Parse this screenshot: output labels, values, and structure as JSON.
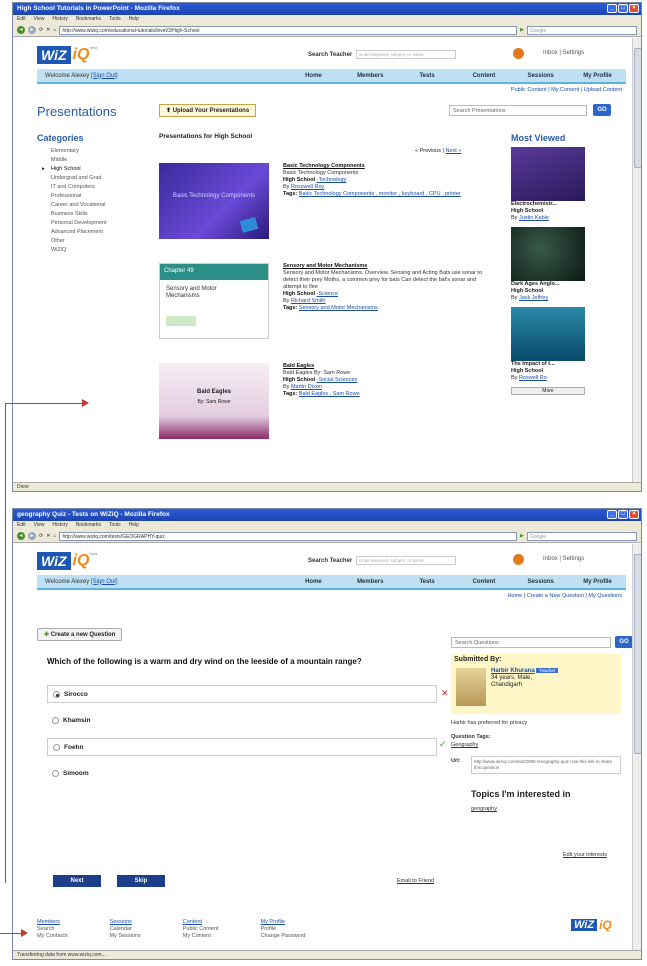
{
  "window1": {
    "title": "High School Tutorials in PowerPoint - Mozilla Firefox",
    "menu": [
      "Edit",
      "View",
      "History",
      "Bookmarks",
      "Tools",
      "Help"
    ],
    "url": "http://www.wiziq.com/educational-tutorials/level/3/High-School",
    "google": "Google",
    "status": "Done",
    "header": {
      "search_label": "Search Teacher",
      "search_placeholder": "Enter keyword, subject, or name",
      "inbox_settings": "Inbox  |  Settings",
      "welcome_text": "Welcome Alexey",
      "sign_out": "[Sign Out]",
      "tabs": [
        "Home",
        "Members",
        "Tests",
        "Content",
        "Sessions",
        "My Profile"
      ],
      "subnav": "Public Content | My Content | Upload Content"
    },
    "page_title": "Presentations",
    "upload_button": "Upload Your Presentations",
    "search_placeholder": "Search Presentations",
    "go": "GO",
    "categories_title": "Categories",
    "categories": [
      "Elementary",
      "Middle",
      "High School",
      "Undergrad and Grad",
      "IT and Computers",
      "Professional",
      "Career and Vocational",
      "Business Skills",
      "Personal Development",
      "Advanced Placement",
      "Other",
      "WiZiQ"
    ],
    "selected_category": "High School",
    "list_heading": "Presentations for High School",
    "pager": {
      "prev": "« Previous",
      "sep": " | ",
      "next": "Next »"
    },
    "presentations": [
      {
        "title": "Basic Technology Components",
        "desc": "Basic Technology Components",
        "level": "High School",
        "subject": "-Technology",
        "by": "By",
        "author": "Rosswell Roy",
        "tags_label": "Tags:",
        "tags": "Basic Technology Components , monitor , keyboard , CPU , printer",
        "slide_title": "Basic Technology Components"
      },
      {
        "title": "Sensory and Motor Mechanisms",
        "desc": "Sensory and Motor Mechanisms. Overview. Sensing and Acting Bats use sonar to detect their prey Moths, a common prey for bats Can detect the bat's sonar and attempt to flee",
        "level": "High School",
        "subject": "-Science",
        "by": "By",
        "author": "Richard Smith",
        "tags_label": "Tags:",
        "tags": "Sensory and Motor Mechanisms",
        "slide_title": "Chapter 49",
        "slide_sub": "Sensory and Motor Mechanisms"
      },
      {
        "title": "Bald Eagles",
        "desc": "Bald Eagles By: Sam Rowe",
        "level": "High School",
        "subject": "-Social Sciences",
        "by": "By",
        "author": "Martin Dixon",
        "tags_label": "Tags:",
        "tags": "Bald Eagles , Sam Rowe",
        "slide_title": "Bald Eagles",
        "slide_sub": "By: Sam Rowe"
      }
    ],
    "most_viewed_title": "Most Viewed",
    "most_viewed": [
      {
        "title": "Electrochemistr...",
        "level": "High School",
        "by": "By",
        "author": "Justin Kable"
      },
      {
        "title": "Dark Ages Anglo...",
        "level": "High School",
        "by": "By",
        "author": "Jack Jeffrey"
      },
      {
        "title": "The Impact of t...",
        "level": "High School",
        "by": "By",
        "author": "Roswell Ro"
      }
    ],
    "more_label": "More"
  },
  "window2": {
    "title": "geography Quiz - Tests on WiZiQ - Mozilla Firefox",
    "menu": [
      "Edit",
      "View",
      "History",
      "Bookmarks",
      "Tools",
      "Help"
    ],
    "url": "http://www.wiziq.com/tests/GEOGRAPHY-quiz",
    "google": "Google",
    "status": "Transferring data from www.wiziq.com...",
    "header": {
      "search_label": "Search Teacher",
      "search_placeholder": "Enter keyword, subject, or name",
      "inbox_settings": "Inbox  |  Settings",
      "welcome_text": "Welcome Alexey",
      "sign_out": "[Sign Out]",
      "tabs": [
        "Home",
        "Members",
        "Tests",
        "Content",
        "Sessions",
        "My Profile"
      ],
      "subnav": "Home | Create a New Question | My Questions"
    },
    "create_button": "Create a new Question",
    "question": "Which of the following is a warm and dry wind on the leeside of a mountain range?",
    "options": [
      "Sirocco",
      "Khamsin",
      "Foehn",
      "Simoom"
    ],
    "selected_option": "Sirocco",
    "wrong_mark": "✕",
    "right_mark": "✓",
    "search_placeholder": "Search Questions",
    "go": "GO",
    "submitted_by_label": "Submitted By:",
    "submitter": {
      "name": "Harbir Khurana",
      "badge": "Teacher",
      "line1": "34 years, Male,",
      "line2": "Chandigarh"
    },
    "privacy_note": "Harbir has preferred for privacy",
    "question_tags_label": "Question Tags:",
    "question_tags": "Geography",
    "url_label": "Url:",
    "question_url": "http://www.wiziq.com/test/2095-Geography-quiz Use this link to share this question",
    "topics_title": "Topics I'm interested in",
    "topics": "geography",
    "edit_interests": "Edit your interests",
    "next_button": "Next",
    "skip_button": "Skip",
    "email_friend": "Email to Friend",
    "footer": [
      {
        "head": "Members",
        "items": [
          "Search",
          "My Contacts"
        ]
      },
      {
        "head": "Sessions",
        "items": [
          "Calendar",
          "My Sessions"
        ]
      },
      {
        "head": "Content",
        "items": [
          "Public Content",
          "My Content"
        ]
      },
      {
        "head": "My Profile",
        "items": [
          "Profile",
          "Change Password"
        ]
      }
    ]
  },
  "colors": {
    "brand_blue": "#1d58b4",
    "brand_orange": "#f28a1a",
    "tab_bar": "#bfe0f2",
    "annotation": "#c0392b"
  }
}
